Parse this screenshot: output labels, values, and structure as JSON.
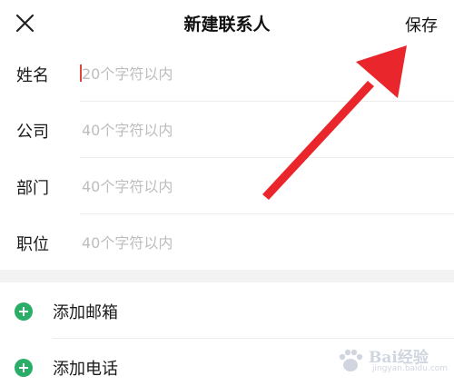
{
  "header": {
    "title": "新建联系人",
    "save_label": "保存",
    "close_icon": "close-icon"
  },
  "form": {
    "fields": [
      {
        "label": "姓名",
        "placeholder": "20个字符以内",
        "value": ""
      },
      {
        "label": "公司",
        "placeholder": "40个字符以内",
        "value": ""
      },
      {
        "label": "部门",
        "placeholder": "40个字符以内",
        "value": ""
      },
      {
        "label": "职位",
        "placeholder": "40个字符以内",
        "value": ""
      }
    ]
  },
  "actions": [
    {
      "label": "添加邮箱",
      "icon": "plus-circle-icon"
    },
    {
      "label": "添加电话",
      "icon": "plus-circle-icon"
    }
  ],
  "watermark": {
    "text": "Bai经验",
    "sub": "jingyan.baidu.com"
  },
  "colors": {
    "accent_green": "#2aae67",
    "arrow_red": "#e8262b",
    "caret_red": "#e0443a",
    "placeholder": "#bdbdbd"
  }
}
